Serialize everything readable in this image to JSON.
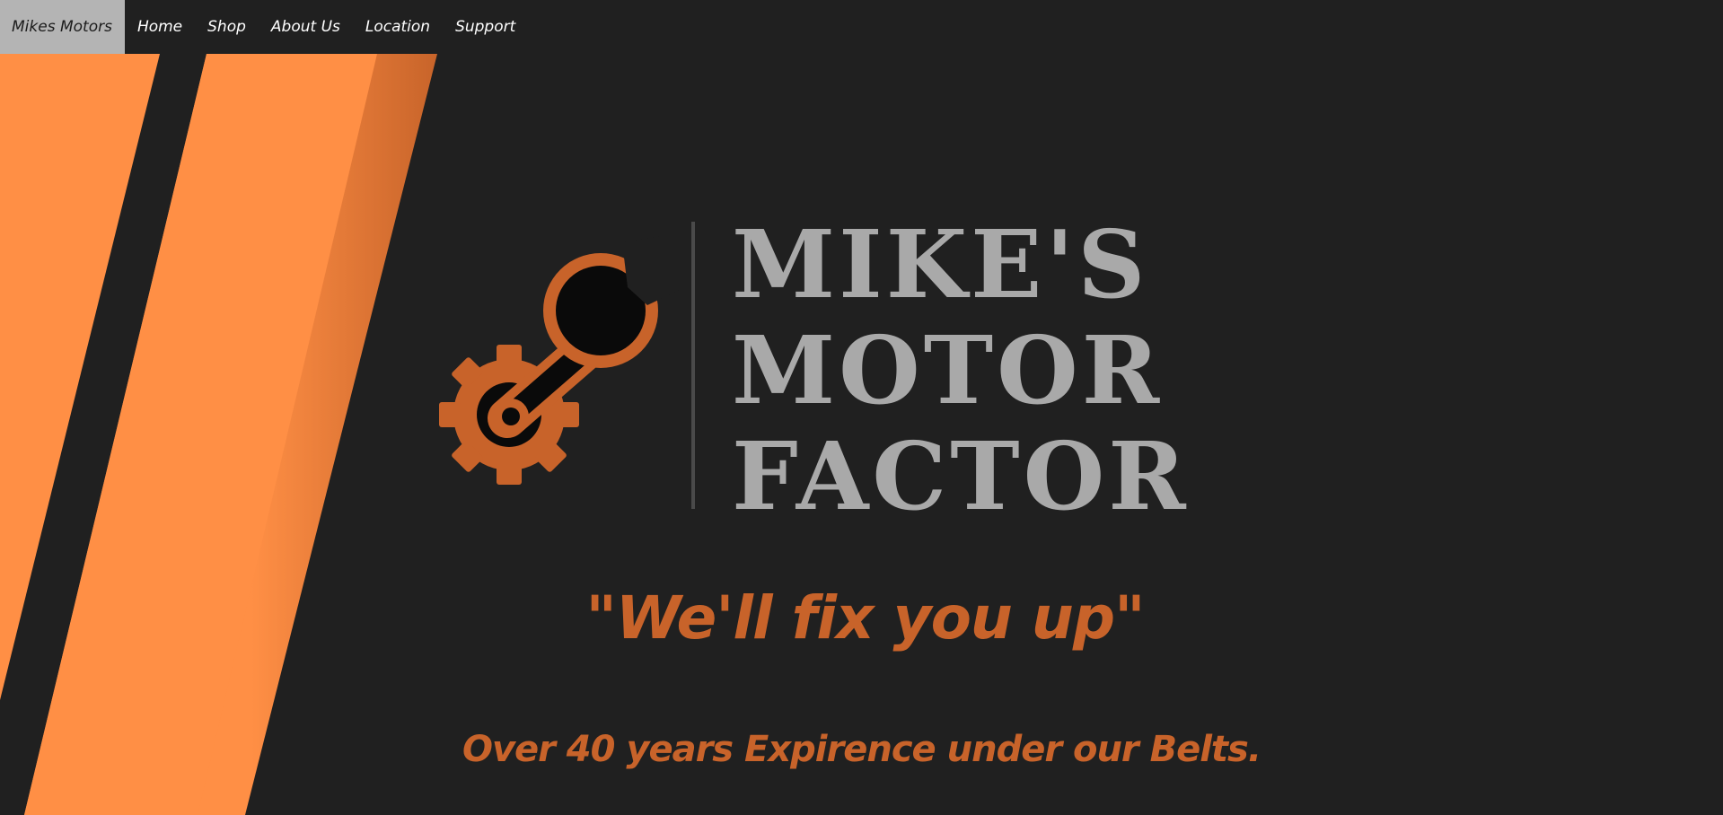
{
  "nav": {
    "brand": "Mikes Motors",
    "items": [
      "Home",
      "Shop",
      "About Us",
      "Location",
      "Support"
    ]
  },
  "logo": {
    "line1": "MIKE'S",
    "line2": "MOTOR",
    "line3": "FACTOR",
    "icon": "gear-wrench-icon"
  },
  "hero": {
    "tagline": "\"We'll fix you up\"",
    "subtitle": "Over 40 years Expirence under our Belts."
  },
  "colors": {
    "background": "#202020",
    "accent_orange": "#ff8c42",
    "brand_orange": "#c8632a",
    "logo_grey": "#a9a9a9",
    "nav_brand_bg": "#b4b4b4"
  }
}
